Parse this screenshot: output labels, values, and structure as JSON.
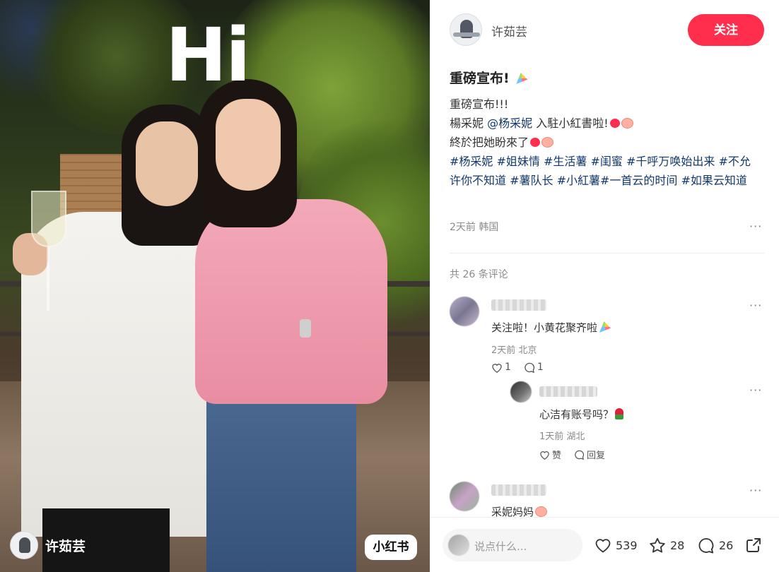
{
  "photo": {
    "overlay_text": "Hi",
    "author_name": "许茹芸",
    "badge": "小红书"
  },
  "header": {
    "author_name": "许茹芸",
    "follow_label": "关注"
  },
  "note": {
    "title": "重磅宣布!",
    "lines": [
      "重磅宣布!!!",
      "楊采妮 @杨采妮 入駐小紅書啦!",
      "終於把她盼來了"
    ],
    "line2_prefix": "楊采妮 ",
    "line2_mention": "@杨采妮",
    "line2_suffix": " 入駐小紅書啦!",
    "tags_text": "#杨采妮 #姐妹情 #生活薯 #闺蜜 #千呼万唤始出来 #不允许你不知道 #薯队长 #小紅薯#一首云的时间 #如果云知道",
    "meta": "2天前 韩国"
  },
  "comments": {
    "count_label": "共 26 条评论",
    "items": [
      {
        "text": "关注啦！小黄花聚齐啦",
        "meta": "2天前 北京",
        "likes": "1",
        "replies": "1",
        "reply": {
          "text": "心洁有账号吗？",
          "meta": "1天前 湖北",
          "like_label": "赞",
          "reply_label": "回复"
        }
      },
      {
        "text": "采妮妈妈"
      }
    ]
  },
  "bottom": {
    "input_placeholder": "说点什么...",
    "likes": "539",
    "collects": "28",
    "comments": "26"
  },
  "colors": {
    "accent": "#ff2e4d",
    "tag": "#13386c"
  },
  "icons": [
    "heart-icon",
    "star-icon",
    "chat-bubble-icon",
    "share-icon",
    "more-icon",
    "party-popper-icon"
  ]
}
